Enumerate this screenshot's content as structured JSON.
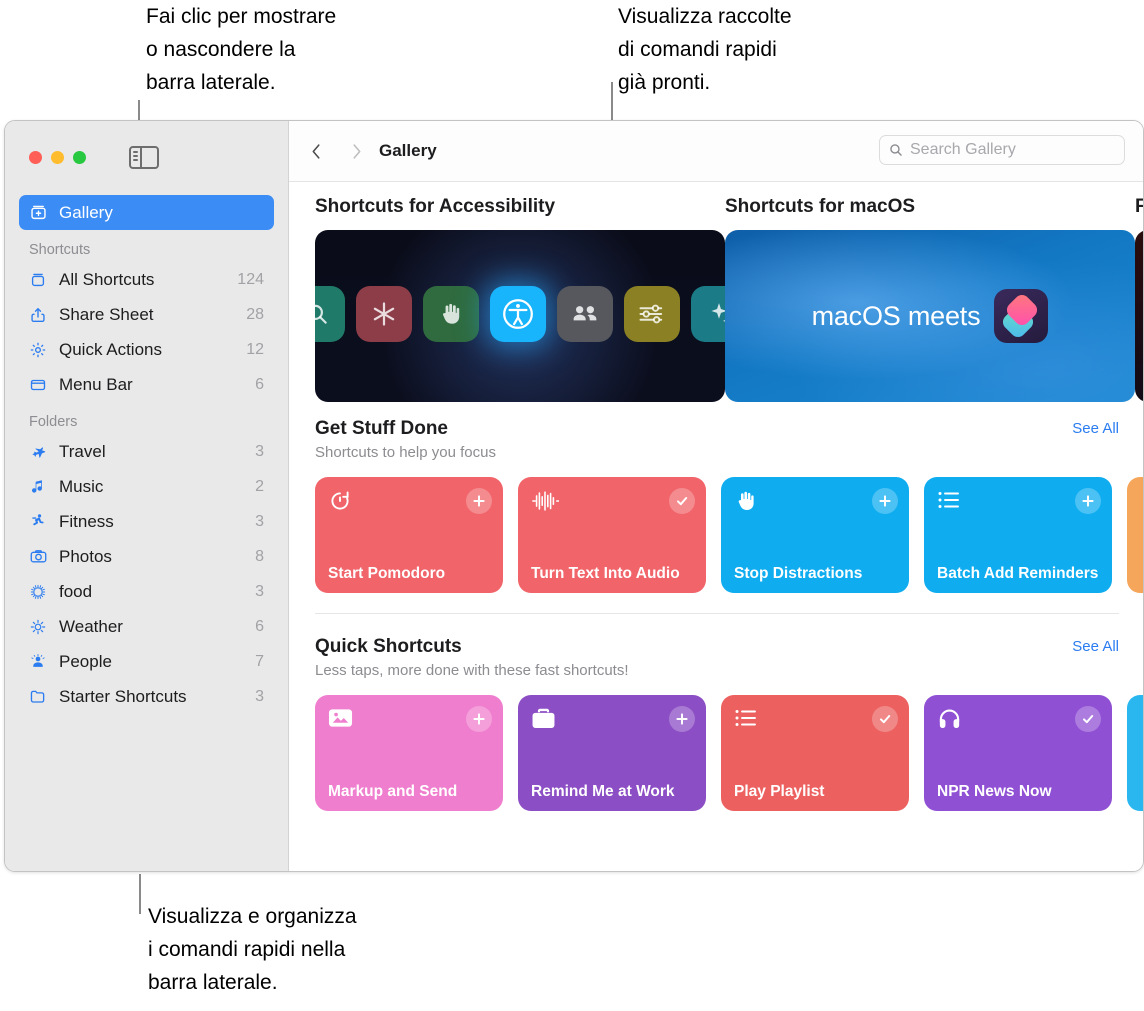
{
  "annotations": [
    {
      "id": "toggle-sidebar",
      "text": "Fai clic per mostrare\no nascondere la\nbarra laterale."
    },
    {
      "id": "view-collections",
      "text": "Visualizza raccolte\ndi comandi rapidi\ngià pronti."
    },
    {
      "id": "organize-sidebar",
      "text": "Visualizza e organizza\ni comandi rapidi nella\nbarra laterale."
    }
  ],
  "window": {
    "traffic_lights": {
      "close": "close",
      "minimize": "minimize",
      "zoom": "zoom"
    },
    "sidebar_toggle": "sidebar-toggle"
  },
  "sidebar": {
    "gallery": {
      "label": "Gallery",
      "icon": "gallery-icon"
    },
    "sections": [
      {
        "header": "Shortcuts",
        "items": [
          {
            "label": "All Shortcuts",
            "count": "124",
            "icon": "shortcuts-icon"
          },
          {
            "label": "Share Sheet",
            "count": "28",
            "icon": "share-icon"
          },
          {
            "label": "Quick Actions",
            "count": "12",
            "icon": "gear-icon"
          },
          {
            "label": "Menu Bar",
            "count": "6",
            "icon": "menubar-icon"
          }
        ]
      },
      {
        "header": "Folders",
        "items": [
          {
            "label": "Travel",
            "count": "3",
            "icon": "airplane-icon"
          },
          {
            "label": "Music",
            "count": "2",
            "icon": "music-note-icon"
          },
          {
            "label": "Fitness",
            "count": "3",
            "icon": "runner-icon"
          },
          {
            "label": "Photos",
            "count": "8",
            "icon": "camera-icon"
          },
          {
            "label": "food",
            "count": "3",
            "icon": "sparkle-circle-icon"
          },
          {
            "label": "Weather",
            "count": "6",
            "icon": "sun-icon"
          },
          {
            "label": "People",
            "count": "7",
            "icon": "person-icon"
          },
          {
            "label": "Starter Shortcuts",
            "count": "3",
            "icon": "folder-icon"
          }
        ]
      }
    ]
  },
  "toolbar": {
    "back": "back-icon",
    "forward": "forward-icon",
    "title": "Gallery",
    "search_placeholder": "Search Gallery",
    "search_value": "",
    "search_icon": "search-icon"
  },
  "collections": [
    {
      "title": "Shortcuts for Accessibility",
      "banner_kind": "accessibility"
    },
    {
      "title": "Shortcuts for macOS",
      "banner_kind": "macos",
      "banner_text": "macOS meets",
      "logo": "shortcuts-app-icon"
    },
    {
      "title": "F",
      "banner_kind": "cut"
    }
  ],
  "accessibility_tiles": [
    {
      "icon": "magnifier-icon",
      "color": "#1f7a6a"
    },
    {
      "icon": "asterisk-icon",
      "color": "#8c3d48"
    },
    {
      "icon": "hand-raised-icon",
      "color": "#2f6b3e"
    },
    {
      "icon": "accessibility-icon",
      "color": "#18b4fc",
      "highlight": true
    },
    {
      "icon": "two-persons-icon",
      "color": "#56585e"
    },
    {
      "icon": "sliders-icon",
      "color": "#8b8023"
    },
    {
      "icon": "sparkle-icon",
      "color": "#1b7b86"
    }
  ],
  "sections": [
    {
      "title": "Get Stuff Done",
      "subtitle": "Shortcuts to help you focus",
      "see_all": "See All",
      "cards": [
        {
          "name": "Start Pomodoro",
          "icon": "timer-icon",
          "badge": "plus",
          "color": "#f0646a"
        },
        {
          "name": "Turn Text Into Audio",
          "icon": "waveform-icon",
          "badge": "check",
          "color": "#f0646a"
        },
        {
          "name": "Stop Distractions",
          "icon": "hand-raised-icon",
          "badge": "plus",
          "color": "#0fadf0"
        },
        {
          "name": "Batch Add Reminders",
          "icon": "list-bullet-icon",
          "badge": "plus",
          "color": "#0fadf0"
        },
        {
          "name": "",
          "icon": "",
          "badge": "",
          "color": "#f5a65b"
        }
      ]
    },
    {
      "title": "Quick Shortcuts",
      "subtitle": "Less taps, more done with these fast shortcuts!",
      "see_all": "See All",
      "cards": [
        {
          "name": "Markup and Send",
          "icon": "photo-icon",
          "badge": "plus",
          "color": "#f07ece"
        },
        {
          "name": "Remind Me at Work",
          "icon": "briefcase-icon",
          "badge": "plus",
          "color": "#8b4ec4"
        },
        {
          "name": "Play Playlist",
          "icon": "list-bullet-icon",
          "badge": "check",
          "color": "#ed6060"
        },
        {
          "name": "NPR News Now",
          "icon": "headphones-icon",
          "badge": "check",
          "color": "#9050d4"
        },
        {
          "name": "",
          "icon": "",
          "badge": "",
          "color": "#2ab7f0"
        }
      ]
    }
  ]
}
